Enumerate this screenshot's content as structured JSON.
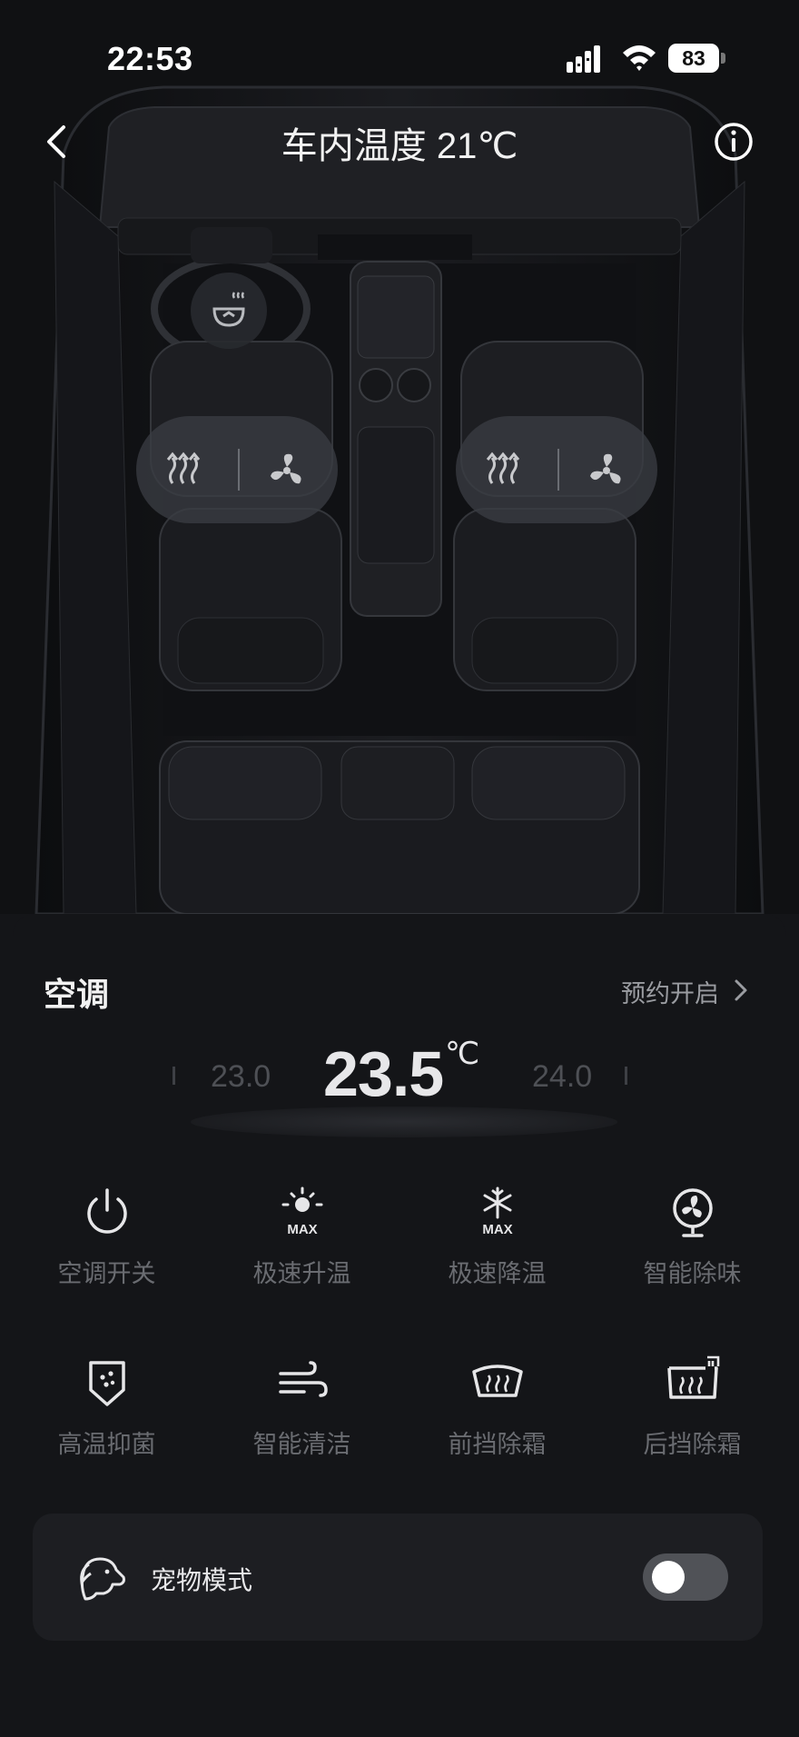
{
  "status_bar": {
    "time": "22:53",
    "battery": "83"
  },
  "header": {
    "title": "车内温度 21℃"
  },
  "ac": {
    "title": "空调",
    "schedule_label": "预约开启",
    "temperature": {
      "current": "23.5",
      "unit": "℃",
      "prev": "23.0",
      "next": "24.0"
    }
  },
  "functions": [
    {
      "label": "空调开关",
      "icon": "power-icon"
    },
    {
      "label": "极速升温",
      "icon": "sun-max-icon"
    },
    {
      "label": "极速降温",
      "icon": "snowflake-max-icon"
    },
    {
      "label": "智能除味",
      "icon": "fan-icon"
    },
    {
      "label": "高温抑菌",
      "icon": "shield-dots-icon"
    },
    {
      "label": "智能清洁",
      "icon": "wind-icon"
    },
    {
      "label": "前挡除霜",
      "icon": "front-defrost-icon"
    },
    {
      "label": "后挡除霜",
      "icon": "rear-defrost-icon"
    }
  ],
  "pet_mode": {
    "label": "宠物模式",
    "enabled": false
  },
  "colors": {
    "background": "#141518",
    "card": "#1d1e22",
    "toggle_off": "#505257"
  }
}
